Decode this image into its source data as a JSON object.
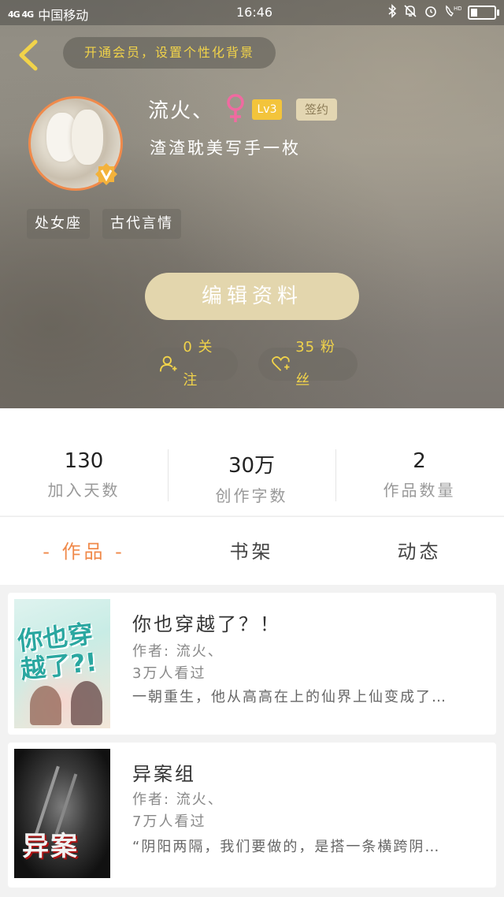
{
  "status_bar": {
    "signal": "4G 4G",
    "carrier": "中国移动",
    "time": "16:46",
    "right_icons": [
      "bluetooth-icon",
      "bell-muted-icon",
      "alarm-icon",
      "hd-call-icon",
      "battery-icon"
    ]
  },
  "header": {
    "vip_banner": "开通会员，设置个性化背景"
  },
  "profile": {
    "name": "流火、",
    "level": "Lv3",
    "sign_badge": "签约",
    "bio": "渣渣耽美写手一枚",
    "tags": [
      "处女座",
      "古代言情"
    ],
    "edit_button": "编辑资料",
    "following": "0 关注",
    "followers": "35 粉丝"
  },
  "stats": [
    {
      "value": "130",
      "label": "加入天数"
    },
    {
      "value": "30万",
      "label": "创作字数"
    },
    {
      "value": "2",
      "label": "作品数量"
    }
  ],
  "tabs": [
    {
      "label": "- 作品 -",
      "active": true
    },
    {
      "label": "书架",
      "active": false
    },
    {
      "label": "动态",
      "active": false
    }
  ],
  "books": [
    {
      "title": "你也穿越了？！",
      "author": "作者: 流火、",
      "views": "3万人看过",
      "desc": "一朝重生，他从高高在上的仙界上仙变成了…",
      "cover_text": "你也穿越了?!"
    },
    {
      "title": "异案组",
      "author": "作者: 流火、",
      "views": "7万人看过",
      "desc": "“阴阳两隔，我们要做的，是搭一条横跨阴…",
      "cover_text": "异案"
    }
  ],
  "colors": {
    "accent_orange": "#f08a4b",
    "vip_yellow": "#f1d34a",
    "edit_button_bg": "#e3d6ad"
  }
}
